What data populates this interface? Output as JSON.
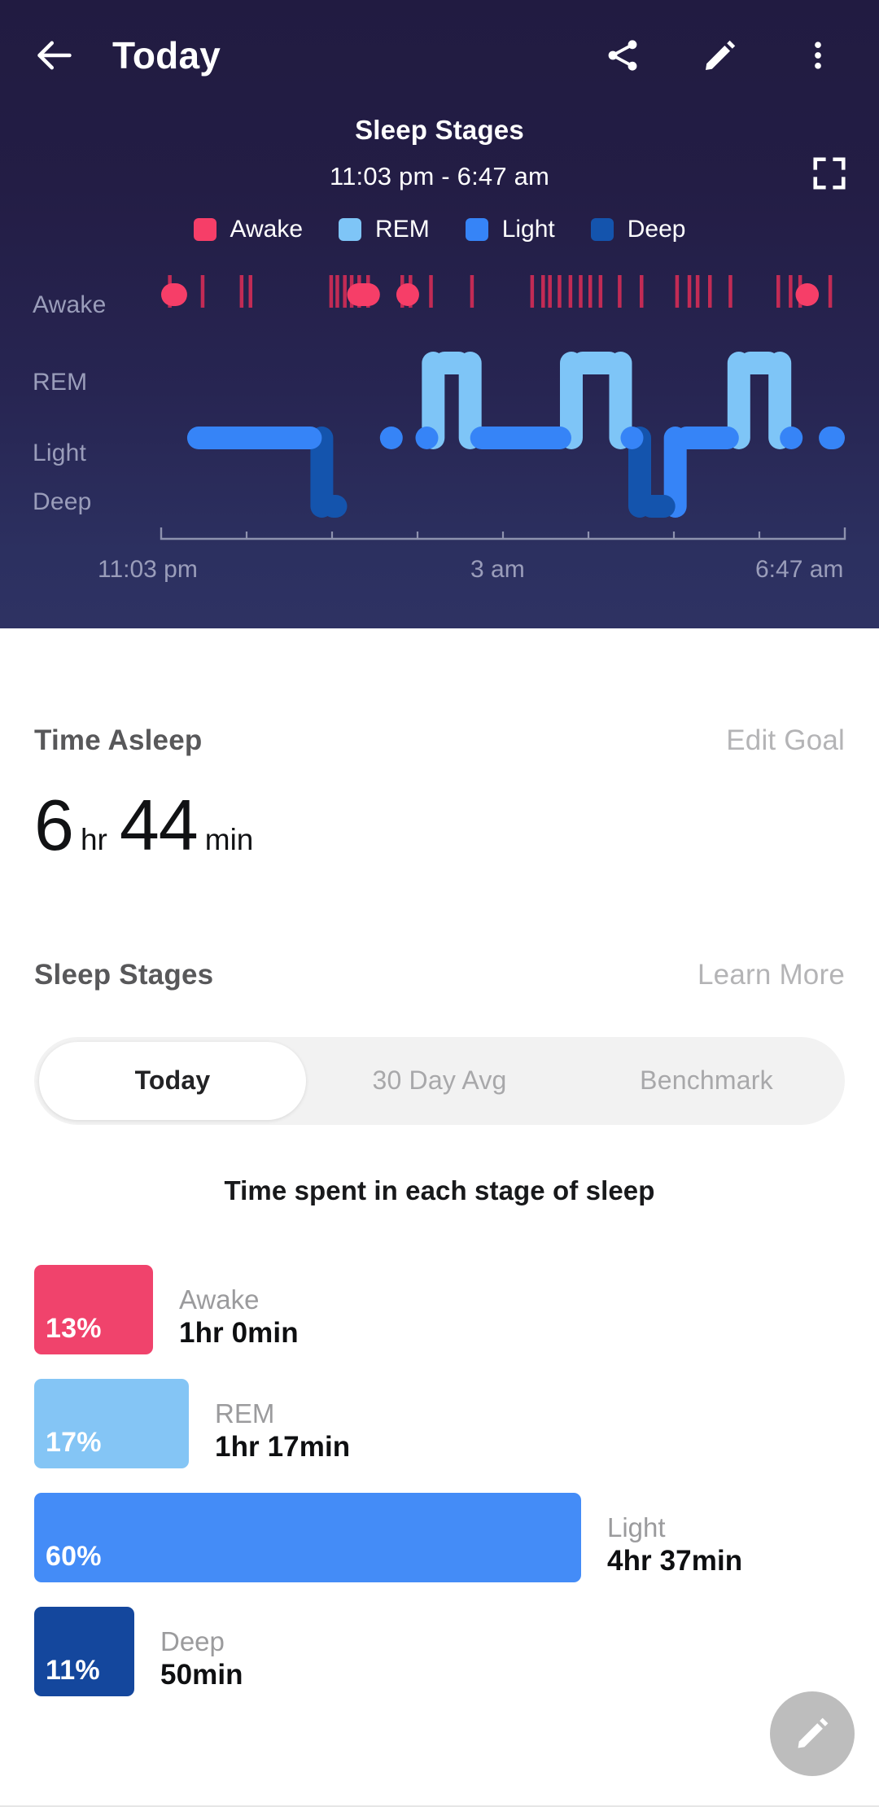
{
  "appbar": {
    "back_icon": "arrow-left-icon",
    "title": "Today",
    "share_icon": "share-icon",
    "edit_icon": "pencil-icon",
    "more_icon": "more-vertical-icon"
  },
  "hero_chart": {
    "title": "Sleep Stages",
    "subtitle": "11:03 pm - 6:47 am",
    "expand_icon": "fullscreen-icon",
    "legend": [
      {
        "label": "Awake",
        "color": "#f63e68"
      },
      {
        "label": "REM",
        "color": "#7ec5f7"
      },
      {
        "label": "Light",
        "color": "#3684f7"
      },
      {
        "label": "Deep",
        "color": "#1454ad"
      }
    ],
    "y_labels": [
      "Awake",
      "REM",
      "Light",
      "Deep"
    ],
    "x_labels": [
      "11:03 pm",
      "3 am",
      "6:47 am"
    ]
  },
  "time_asleep": {
    "title": "Time Asleep",
    "action": "Edit Goal",
    "hours": "6",
    "hours_unit": "hr",
    "minutes": "44",
    "minutes_unit": "min"
  },
  "sleep_stages": {
    "title": "Sleep Stages",
    "action": "Learn More",
    "tabs": [
      {
        "label": "Today",
        "active": true
      },
      {
        "label": "30 Day Avg",
        "active": false
      },
      {
        "label": "Benchmark",
        "active": false
      }
    ],
    "subtitle": "Time spent in each stage of sleep",
    "rows": [
      {
        "pct": "13%",
        "name": "Awake",
        "time": "1hr 0min",
        "color": "#f0436c",
        "value": 13
      },
      {
        "pct": "17%",
        "name": "REM",
        "time": "1hr 17min",
        "color": "#84c5f5",
        "value": 17
      },
      {
        "pct": "60%",
        "name": "Light",
        "time": "4hr 37min",
        "color": "#448cf7",
        "value": 60
      },
      {
        "pct": "11%",
        "name": "Deep",
        "time": "50min",
        "color": "#14479d",
        "value": 11
      }
    ]
  },
  "fab": {
    "icon": "pencil-icon"
  },
  "chart_data": {
    "type": "area",
    "title": "Sleep Stages",
    "subtitle": "11:03 pm - 6:47 am",
    "xlabel": "",
    "ylabel": "",
    "grid": false,
    "legend_position": "top",
    "stage_levels": [
      "Awake",
      "REM",
      "Light",
      "Deep"
    ],
    "stage_colors": {
      "Awake": "#f63e68",
      "REM": "#7ec5f7",
      "Light": "#3684f7",
      "Deep": "#1454ad"
    },
    "x_range": [
      "11:03 pm",
      "6:47 am"
    ],
    "x_tick_labels": [
      "11:03 pm",
      "3 am",
      "6:47 am"
    ],
    "x_tick_count": 9,
    "segments": [
      {
        "stage": "Awake",
        "start": 0.0,
        "end": 0.038
      },
      {
        "stage": "Light",
        "start": 0.038,
        "end": 0.235
      },
      {
        "stage": "Deep",
        "start": 0.235,
        "end": 0.272
      },
      {
        "stage": "Awake",
        "start": 0.272,
        "end": 0.32
      },
      {
        "stage": "Light",
        "start": 0.32,
        "end": 0.344
      },
      {
        "stage": "Awake",
        "start": 0.344,
        "end": 0.372
      },
      {
        "stage": "Light",
        "start": 0.372,
        "end": 0.398
      },
      {
        "stage": "REM",
        "start": 0.398,
        "end": 0.452
      },
      {
        "stage": "Light",
        "start": 0.452,
        "end": 0.6
      },
      {
        "stage": "REM",
        "start": 0.6,
        "end": 0.672
      },
      {
        "stage": "Light",
        "start": 0.672,
        "end": 0.7
      },
      {
        "stage": "Deep",
        "start": 0.7,
        "end": 0.752
      },
      {
        "stage": "Light",
        "start": 0.752,
        "end": 0.845
      },
      {
        "stage": "REM",
        "start": 0.845,
        "end": 0.905
      },
      {
        "stage": "Light",
        "start": 0.905,
        "end": 0.928
      },
      {
        "stage": "Awake",
        "start": 0.928,
        "end": 0.962
      },
      {
        "stage": "Light",
        "start": 0.962,
        "end": 1.0
      }
    ],
    "brief_awakenings": [
      0.01,
      0.058,
      0.115,
      0.128,
      0.246,
      0.255,
      0.266,
      0.276,
      0.287,
      0.3,
      0.35,
      0.362,
      0.392,
      0.452,
      0.54,
      0.556,
      0.566,
      0.58,
      0.596,
      0.611,
      0.625,
      0.64,
      0.668,
      0.7,
      0.752,
      0.77,
      0.782,
      0.8,
      0.83,
      0.9,
      0.918,
      0.932,
      0.976
    ],
    "summary": {
      "type": "bar",
      "orientation": "horizontal",
      "title": "Time spent in each stage of sleep",
      "categories": [
        "Awake",
        "REM",
        "Light",
        "Deep"
      ],
      "values": [
        13,
        17,
        60,
        11
      ],
      "value_labels": [
        "13%",
        "17%",
        "60%",
        "11%"
      ],
      "durations": [
        "1hr 0min",
        "1hr 17min",
        "4hr 37min",
        "50min"
      ],
      "colors": [
        "#f0436c",
        "#84c5f5",
        "#448cf7",
        "#14479d"
      ],
      "ylim": [
        0,
        100
      ],
      "total_time_asleep": "6 hr 44 min"
    }
  }
}
